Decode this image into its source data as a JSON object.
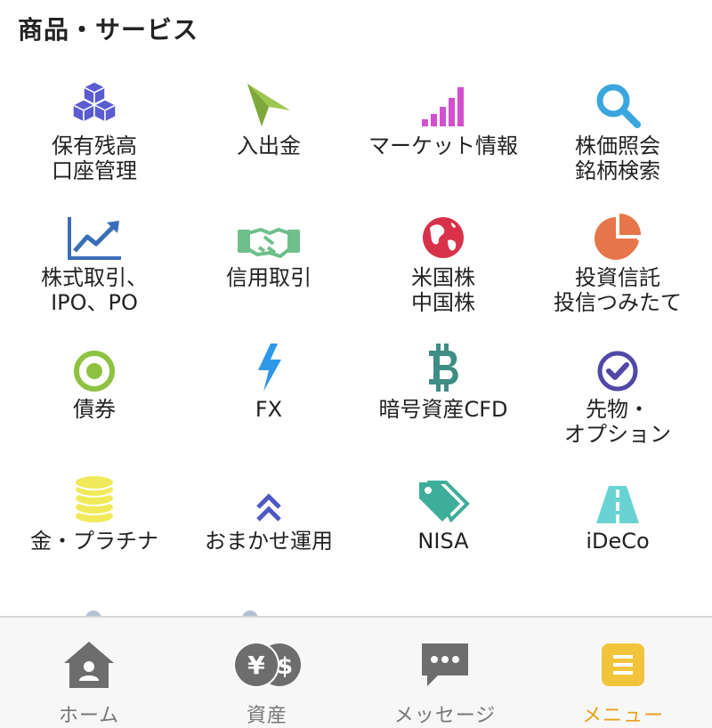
{
  "section": {
    "title": "商品・サービス"
  },
  "tiles": [
    {
      "icon": "cubes-icon",
      "lines": [
        "保有残高",
        "口座管理"
      ]
    },
    {
      "icon": "paper-plane-icon",
      "lines": [
        "入出金"
      ]
    },
    {
      "icon": "signal-bars-icon",
      "lines": [
        "マーケット情報"
      ]
    },
    {
      "icon": "search-icon",
      "lines": [
        "株価照会",
        "銘柄検索"
      ]
    },
    {
      "icon": "line-chart-icon",
      "lines": [
        "株式取引、",
        "IPO、PO"
      ]
    },
    {
      "icon": "handshake-icon",
      "lines": [
        "信用取引"
      ]
    },
    {
      "icon": "globe-icon",
      "lines": [
        "米国株",
        "中国株"
      ]
    },
    {
      "icon": "pie-chart-icon",
      "lines": [
        "投資信託",
        "投信つみたて"
      ]
    },
    {
      "icon": "target-icon",
      "lines": [
        "債券"
      ]
    },
    {
      "icon": "lightning-icon",
      "lines": [
        "FX"
      ]
    },
    {
      "icon": "bitcoin-icon",
      "lines": [
        "暗号資産CFD"
      ]
    },
    {
      "icon": "check-circle-icon",
      "lines": [
        "先物・",
        "オプション"
      ]
    },
    {
      "icon": "coin-stack-icon",
      "lines": [
        "金・プラチナ"
      ]
    },
    {
      "icon": "double-chevron-up-icon",
      "lines": [
        "おまかせ運用"
      ]
    },
    {
      "icon": "tags-icon",
      "lines": [
        "NISA"
      ]
    },
    {
      "icon": "road-icon",
      "lines": [
        "iDeCo"
      ]
    }
  ],
  "tabbar": {
    "items": [
      {
        "icon": "home-icon",
        "label": "ホーム"
      },
      {
        "icon": "yen-dollar-coins-icon",
        "label": "資産"
      },
      {
        "icon": "chat-bubble-icon",
        "label": "メッセージ"
      },
      {
        "icon": "menu-icon",
        "label": "メニュー"
      }
    ],
    "active_color": "#e9a21b"
  },
  "colors": {
    "cubes": "#5b5ccf",
    "plane": "#9cc751",
    "bars": "#d24fd0",
    "search": "#3aa6df",
    "chart": "#3a6fb7",
    "handshake": "#6fbf8c",
    "globe": "#d8324a",
    "pie": "#e6764a",
    "target": "#8fc241",
    "lightning": "#2f97e8",
    "bitcoin": "#3f8d84",
    "check": "#5148a8",
    "coins": "#f0ea5b",
    "chevrons": "#4f58c4",
    "tags": "#3dae9a",
    "road": "#69d3d4",
    "tab_gray": "#6d6d6d",
    "tab_active": "#f2c43c"
  }
}
